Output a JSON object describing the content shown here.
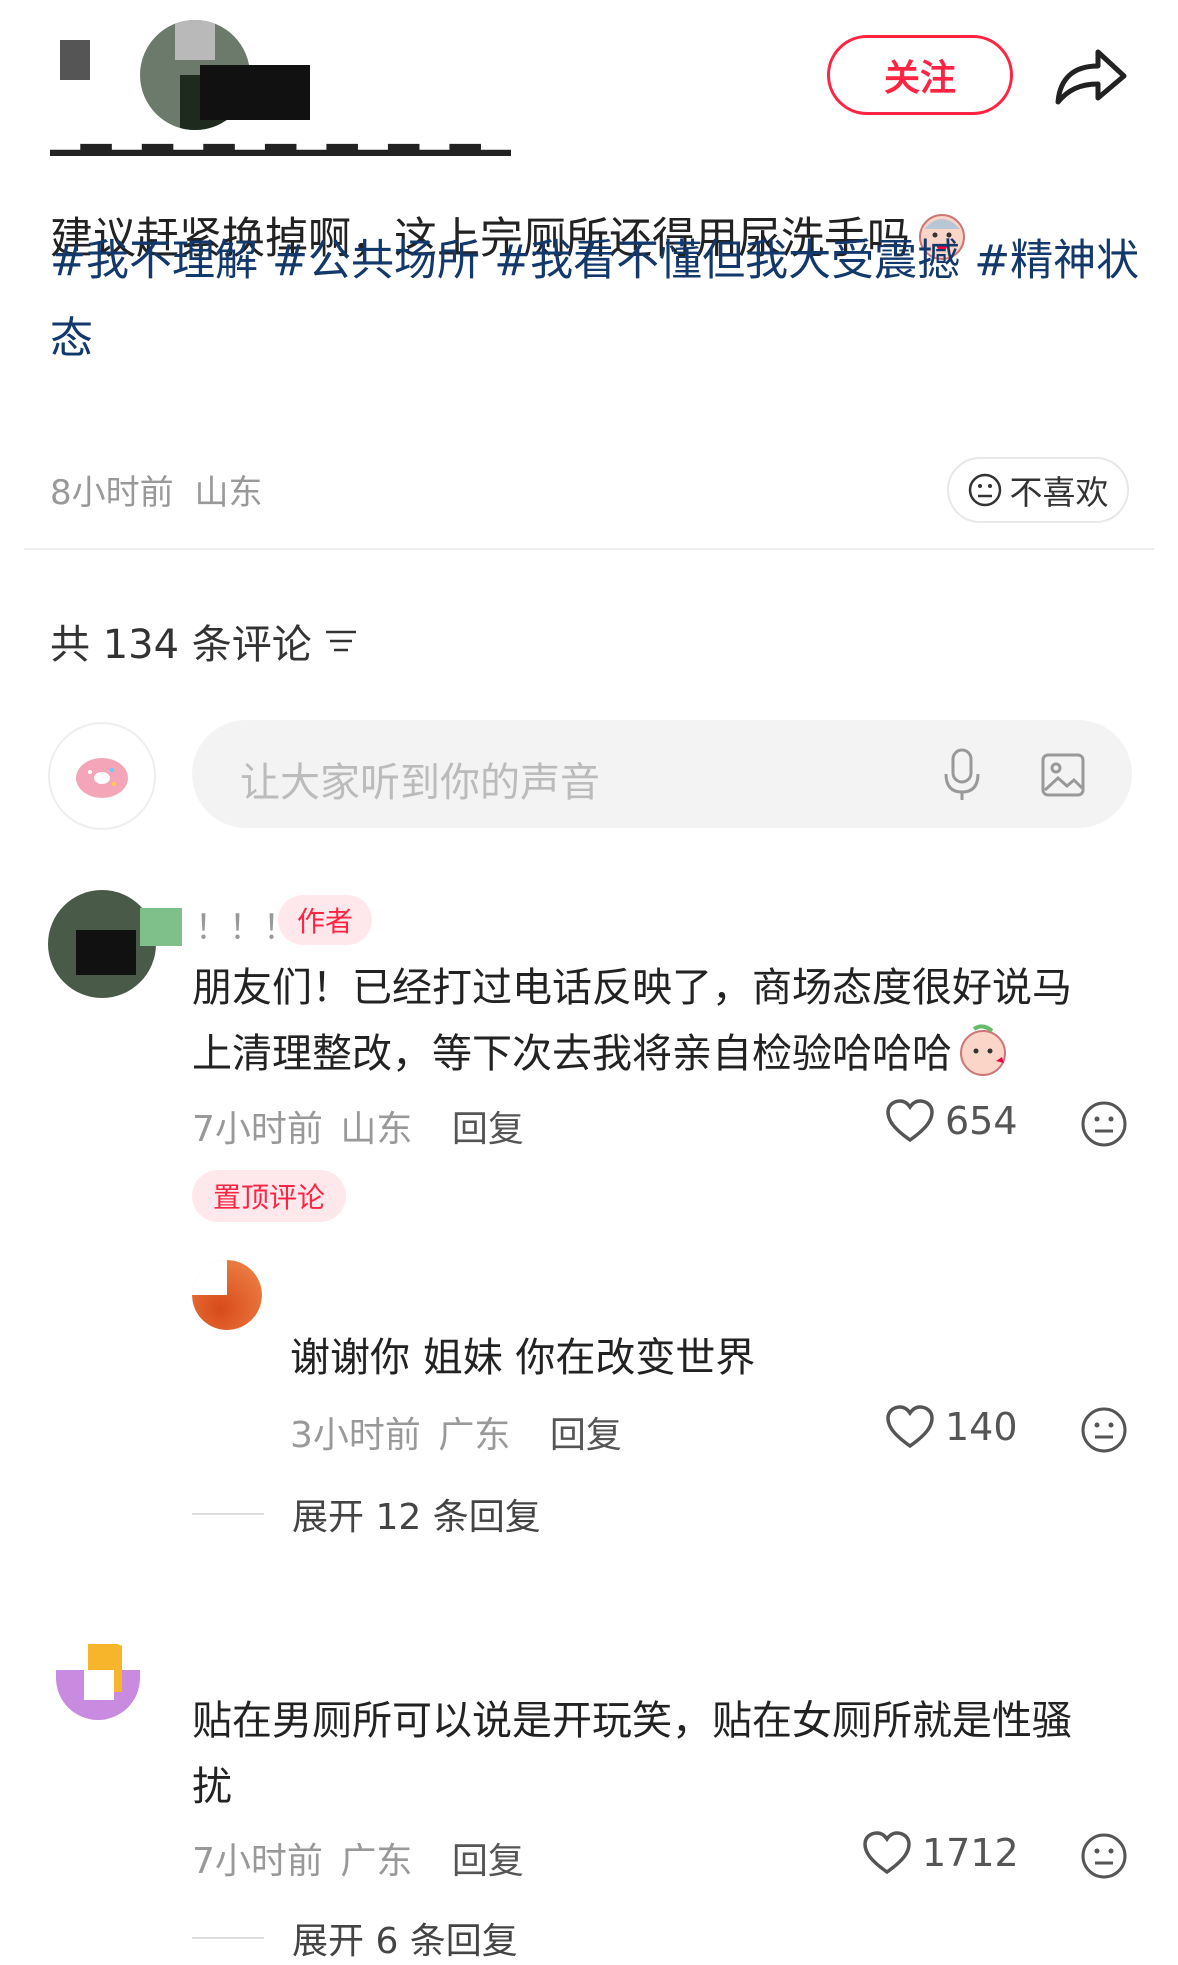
{
  "header": {
    "author_name": "",
    "follow_label": "关注",
    "share_icon": "share-icon"
  },
  "post": {
    "body_text": "建议赶紧换掉啊，这上完厕所还得用尿洗手吗",
    "tags": [
      "#我不理解",
      "#公共场所",
      "#我看不懂但我大受震撼",
      "#精神状态"
    ],
    "time": "8小时前",
    "location": "山东",
    "dislike_label": "不喜欢"
  },
  "comments_header": {
    "label": "共 134 条评论"
  },
  "composer": {
    "placeholder": "让大家听到你的声音"
  },
  "comments": [
    {
      "name": "！！！",
      "badge": "作者",
      "text_line1": "朋友们！已经打过电话反映了，商场态度很好说马",
      "text_line2": "上清理整改，等下次去我将亲自检验哈哈哈",
      "time": "7小时前",
      "location": "山东",
      "reply_label": "回复",
      "likes": "654",
      "pinned_label": "置顶评论",
      "sub_reply": {
        "name": "",
        "text": "谢谢你 姐妹 你在改变世界",
        "time": "3小时前",
        "location": "广东",
        "reply_label": "回复",
        "likes": "140"
      },
      "expand_label": "展开 12 条回复"
    },
    {
      "name": "",
      "text_line1": "贴在男厕所可以说是开玩笑，贴在女厕所就是性骚",
      "text_line2": "扰",
      "time": "7小时前",
      "location": "广东",
      "reply_label": "回复",
      "likes": "1712",
      "expand_label": "展开 6 条回复"
    }
  ],
  "colors": {
    "brand_red": "#ff2442",
    "tag_blue": "#13386c",
    "muted_gray": "#999999"
  }
}
